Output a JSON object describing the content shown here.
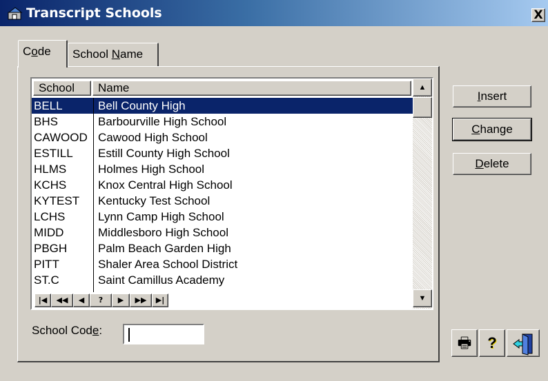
{
  "window": {
    "title": "Transcript Schools",
    "close_label": "X"
  },
  "tabs": [
    {
      "pre": "C",
      "key": "o",
      "post": "de"
    },
    {
      "pre": "School ",
      "key": "N",
      "post": "ame"
    }
  ],
  "grid": {
    "headers": [
      "School",
      "Name"
    ],
    "selected_row": 0,
    "rows": [
      {
        "code": "BELL",
        "name": "Bell County High"
      },
      {
        "code": "BHS",
        "name": "Barbourville High School"
      },
      {
        "code": "CAWOOD",
        "name": "Cawood High School"
      },
      {
        "code": "ESTILL",
        "name": "Estill County High School"
      },
      {
        "code": "HLMS",
        "name": "Holmes High School"
      },
      {
        "code": "KCHS",
        "name": "Knox Central High School"
      },
      {
        "code": "KYTEST",
        "name": "Kentucky Test School"
      },
      {
        "code": "LCHS",
        "name": "Lynn Camp High School"
      },
      {
        "code": "MIDD",
        "name": "Middlesboro High School"
      },
      {
        "code": "PBGH",
        "name": "Palm Beach Garden High"
      },
      {
        "code": "PITT",
        "name": "Shaler Area School District"
      },
      {
        "code": "ST.C",
        "name": "Saint Camillus Academy"
      }
    ],
    "nav": [
      "|◀",
      "◀◀",
      "◀",
      "?",
      "▶",
      "▶▶",
      "▶|"
    ]
  },
  "buttons": {
    "insert": {
      "key": "I",
      "post": "nsert"
    },
    "change": {
      "key": "C",
      "post": "hange"
    },
    "delete": {
      "key": "D",
      "post": "elete"
    }
  },
  "school_code": {
    "pre": "School Cod",
    "key": "e",
    "post": ":",
    "value": ""
  },
  "toolbar": {
    "print_icon": "🖶",
    "help_icon": "?",
    "exit_icon": "exit-door-icon"
  },
  "colors": {
    "selection": "#0a246a",
    "face": "#d4d0c8",
    "title_start": "#0a246a",
    "title_end": "#a6caf0"
  }
}
